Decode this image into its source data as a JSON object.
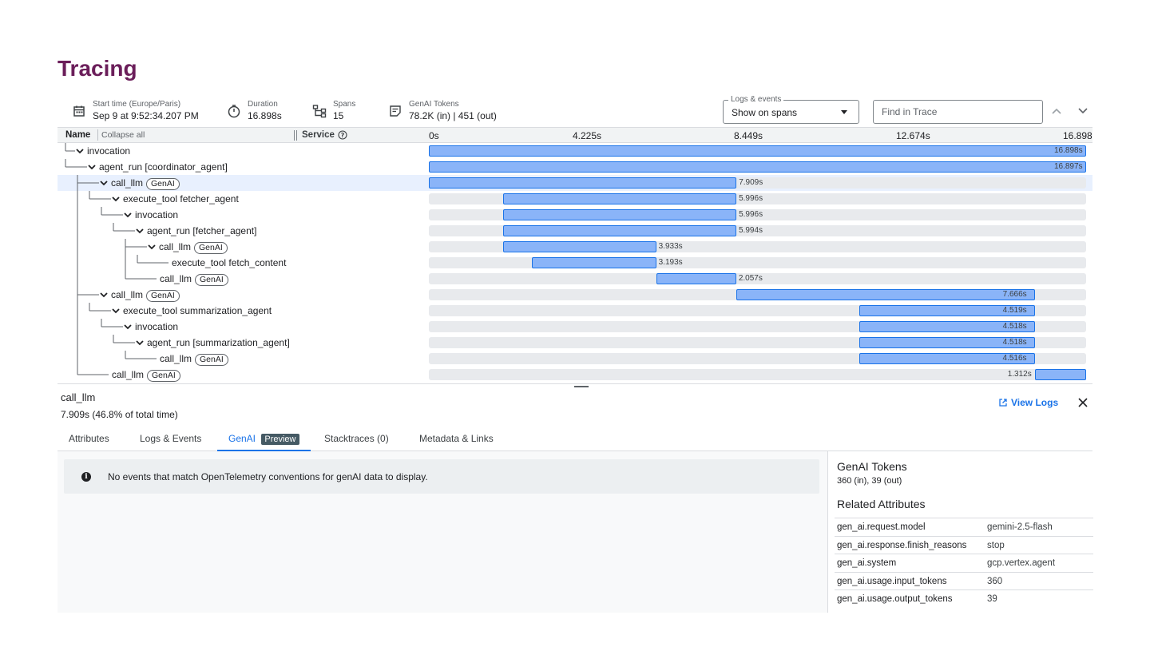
{
  "page": {
    "title": "Tracing"
  },
  "summary": {
    "start_label": "Start time (Europe/Paris)",
    "start_value": "Sep 9 at 9:52:34.207 PM",
    "duration_label": "Duration",
    "duration_value": "16.898s",
    "spans_label": "Spans",
    "spans_value": "15",
    "tokens_label": "GenAI Tokens",
    "tokens_value": "78.2K (in) | 451 (out)"
  },
  "controls": {
    "logs_legend": "Logs & events",
    "logs_value": "Show on spans",
    "find_placeholder": "Find in Trace"
  },
  "grid": {
    "name_header": "Name",
    "collapse_all": "Collapse all",
    "service_header": "Service",
    "ticks": [
      "0s",
      "4.225s",
      "8.449s",
      "12.674s",
      "16.898"
    ],
    "total_seconds": 16.898
  },
  "spans": [
    {
      "name": "invocation",
      "chip": "",
      "depth": 0,
      "chevron": true,
      "start": 0.0,
      "duration": 16.898,
      "label": "16.898s",
      "selected": false
    },
    {
      "name": "agent_run [coordinator_agent]",
      "chip": "",
      "depth": 1,
      "chevron": true,
      "start": 0.0,
      "duration": 16.897,
      "label": "16.897s",
      "selected": false
    },
    {
      "name": "call_llm",
      "chip": "GenAI",
      "depth": 2,
      "chevron": true,
      "start": 0.0,
      "duration": 7.909,
      "label": "7.909s",
      "selected": true
    },
    {
      "name": "execute_tool fetcher_agent",
      "chip": "",
      "depth": 3,
      "chevron": true,
      "start": 1.911,
      "duration": 5.996,
      "label": "5.996s",
      "selected": false
    },
    {
      "name": "invocation",
      "chip": "",
      "depth": 4,
      "chevron": true,
      "start": 1.911,
      "duration": 5.996,
      "label": "5.996s",
      "selected": false
    },
    {
      "name": "agent_run [fetcher_agent]",
      "chip": "",
      "depth": 5,
      "chevron": true,
      "start": 1.911,
      "duration": 5.994,
      "label": "5.994s",
      "selected": false
    },
    {
      "name": "call_llm",
      "chip": "GenAI",
      "depth": 6,
      "chevron": true,
      "start": 1.911,
      "duration": 3.933,
      "label": "3.933s",
      "selected": false
    },
    {
      "name": "execute_tool fetch_content",
      "chip": "",
      "depth": 7,
      "chevron": false,
      "start": 2.651,
      "duration": 3.193,
      "label": "3.193s",
      "selected": false
    },
    {
      "name": "call_llm",
      "chip": "GenAI",
      "depth": 6,
      "chevron": false,
      "start": 5.845,
      "duration": 2.057,
      "label": "2.057s",
      "selected": false
    },
    {
      "name": "call_llm",
      "chip": "GenAI",
      "depth": 2,
      "chevron": true,
      "start": 7.911,
      "duration": 7.666,
      "label": "7.666s",
      "selected": false
    },
    {
      "name": "execute_tool summarization_agent",
      "chip": "",
      "depth": 3,
      "chevron": true,
      "start": 11.058,
      "duration": 4.519,
      "label": "4.519s",
      "selected": false
    },
    {
      "name": "invocation",
      "chip": "",
      "depth": 4,
      "chevron": true,
      "start": 11.058,
      "duration": 4.518,
      "label": "4.518s",
      "selected": false
    },
    {
      "name": "agent_run [summarization_agent]",
      "chip": "",
      "depth": 5,
      "chevron": true,
      "start": 11.058,
      "duration": 4.518,
      "label": "4.518s",
      "selected": false
    },
    {
      "name": "call_llm",
      "chip": "GenAI",
      "depth": 6,
      "chevron": false,
      "start": 11.058,
      "duration": 4.516,
      "label": "4.516s",
      "selected": false
    },
    {
      "name": "call_llm",
      "chip": "GenAI",
      "depth": 2,
      "chevron": false,
      "start": 15.578,
      "duration": 1.312,
      "label": "1.312s",
      "selected": false
    }
  ],
  "details": {
    "span_name": "call_llm",
    "span_duration": "7.909s  (46.8% of total time)",
    "view_logs": "View Logs",
    "tabs": [
      "Attributes",
      "Logs & Events",
      "GenAI",
      "Stacktraces (0)",
      "Metadata & Links"
    ],
    "preview_badge": "Preview",
    "notice": "No events that match OpenTelemetry conventions for genAI data to display.",
    "tokens_title": "GenAI Tokens",
    "tokens_value": "360 (in), 39 (out)",
    "related_title": "Related Attributes",
    "attributes": [
      {
        "key": "gen_ai.request.model",
        "value": "gemini-2.5-flash"
      },
      {
        "key": "gen_ai.response.finish_reasons",
        "value": "stop"
      },
      {
        "key": "gen_ai.system",
        "value": "gcp.vertex.agent"
      },
      {
        "key": "gen_ai.usage.input_tokens",
        "value": "360"
      },
      {
        "key": "gen_ai.usage.output_tokens",
        "value": "39"
      }
    ]
  },
  "colors": {
    "title": "#6b1e5a",
    "bar": "#8ab4f8",
    "bar_border": "#1a73e8",
    "accent": "#1a73e8",
    "selected_row": "#e8f0fe"
  }
}
